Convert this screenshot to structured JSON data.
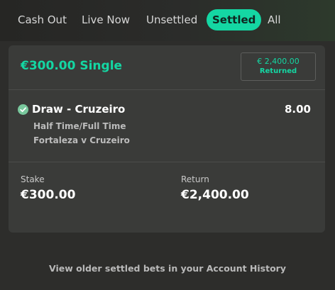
{
  "tabs": [
    {
      "label": "Cash Out",
      "active": false
    },
    {
      "label": "Live Now",
      "active": false
    },
    {
      "label": "Unsettled",
      "active": false
    },
    {
      "label": "Settled",
      "active": true
    },
    {
      "label": "All",
      "active": false
    }
  ],
  "bet": {
    "title": "€300.00 Single",
    "badge_amount": "€ 2,400.00",
    "badge_label": "Returned",
    "selection": {
      "name": "Draw - Cruzeiro",
      "odds": "8.00",
      "market": "Half Time/Full Time",
      "event": "Fortaleza v Cruzeiro",
      "status_icon": "check-circle-icon"
    },
    "stake_label": "Stake",
    "stake_value": "€300.00",
    "return_label": "Return",
    "return_value": "€2,400.00"
  },
  "footer": {
    "history_link": "View older settled bets in your Account History"
  },
  "colors": {
    "accent": "#14d7a3",
    "background": "#2d2d2b",
    "card": "#3a3b39"
  }
}
